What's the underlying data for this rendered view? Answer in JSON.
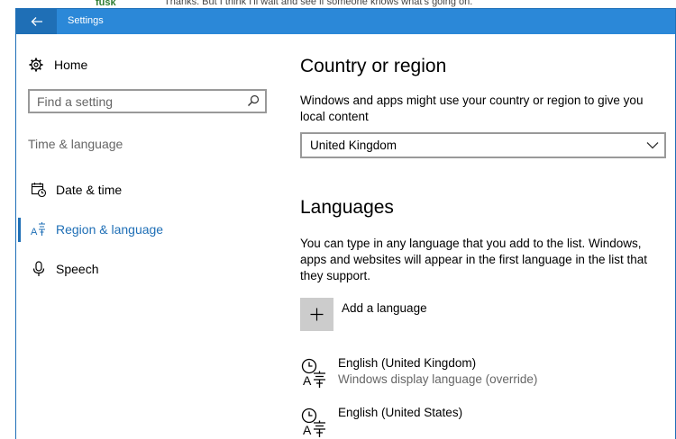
{
  "background": {
    "user": "fusk",
    "text": "Thanks. But I think I'll wait and see if someone knows what's going on."
  },
  "window": {
    "title": "Settings"
  },
  "sidebar": {
    "home_label": "Home",
    "search_placeholder": "Find a setting",
    "section_title": "Time & language",
    "items": [
      {
        "label": "Date & time",
        "icon": "calendar-clock-icon",
        "active": false
      },
      {
        "label": "Region & language",
        "icon": "region-language-icon",
        "active": true
      },
      {
        "label": "Speech",
        "icon": "microphone-icon",
        "active": false
      }
    ]
  },
  "main": {
    "country_heading": "Country or region",
    "country_desc": "Windows and apps might use your country or region to give you local content",
    "country_selected": "United Kingdom",
    "languages_heading": "Languages",
    "languages_desc": "You can type in any language that you add to the list. Windows, apps and websites will appear in the first language in the list that they support.",
    "add_language_label": "Add a language",
    "languages": [
      {
        "name": "English (United Kingdom)",
        "status": "Windows display language (override)"
      },
      {
        "name": "English (United States)",
        "status": ""
      }
    ]
  },
  "colors": {
    "accent": "#1f6fb6",
    "titlebar": "#2b88d8",
    "secondary_text": "#666666"
  }
}
